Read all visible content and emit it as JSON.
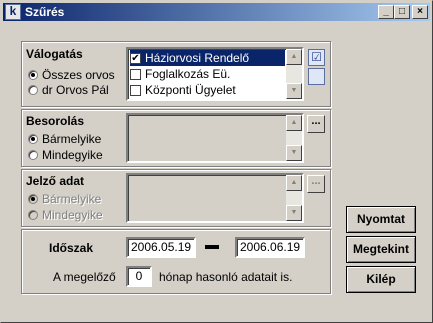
{
  "window": {
    "title": "Szűrés",
    "icon": "app-icon",
    "controls": {
      "minimize": "_",
      "maximize": "□",
      "close": "×"
    }
  },
  "valogatas": {
    "title": "Válogatás",
    "radios": [
      {
        "label": "Összes orvos",
        "checked": true
      },
      {
        "label": "dr Orvos Pál",
        "checked": false
      }
    ],
    "list": [
      {
        "label": "Háziorvosi Rendelő",
        "checked": true,
        "selected": true
      },
      {
        "label": "Foglalkozás Eü.",
        "checked": false,
        "selected": false
      },
      {
        "label": "Központi Ügyelet",
        "checked": false,
        "selected": false
      }
    ],
    "select_all_icon": "check-all-icon",
    "clear_icon": "uncheck-all-icon"
  },
  "besorolas": {
    "title": "Besorolás",
    "radios": [
      {
        "label": "Bármelyike",
        "checked": true
      },
      {
        "label": "Mindegyike",
        "checked": false
      }
    ],
    "more_label": "..."
  },
  "jelzo": {
    "title": "Jelző adat",
    "radios": [
      {
        "label": "Bármelyike",
        "checked": true
      },
      {
        "label": "Mindegyike",
        "checked": false
      }
    ],
    "more_label": "..."
  },
  "period": {
    "label": "Időszak",
    "from": "2006.05.19",
    "to": "2006.06.19",
    "prev_prefix": "A megelőző",
    "prev_value": "0",
    "prev_suffix": "hónap hasonló adatait is."
  },
  "buttons": {
    "print": "Nyomtat",
    "view": "Megtekint",
    "exit": "Kilép"
  }
}
